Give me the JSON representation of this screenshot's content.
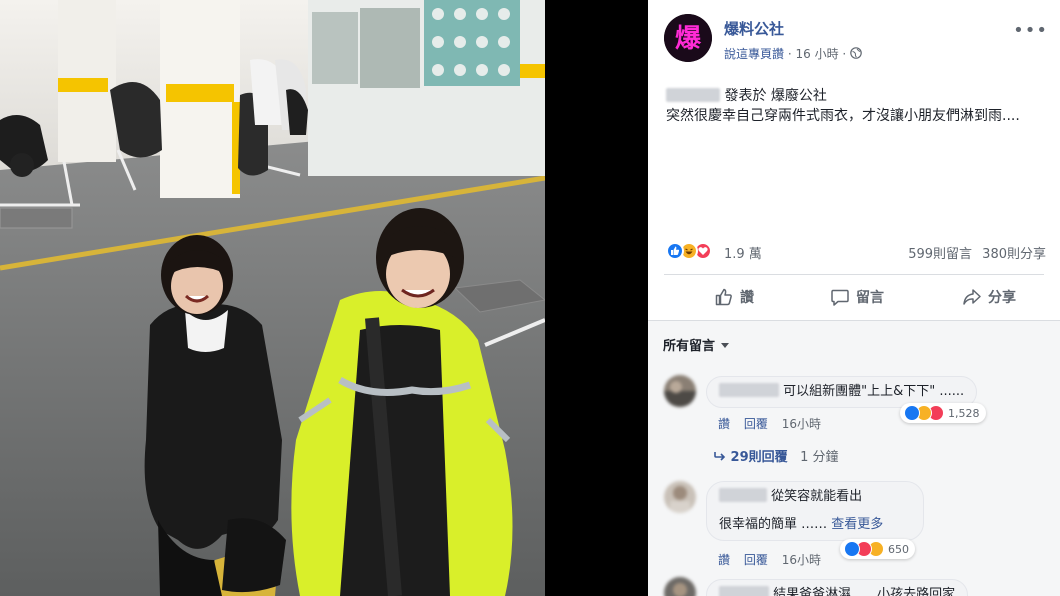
{
  "post": {
    "page_name": "爆料公社",
    "avatar_glyph": "爆",
    "like_page_label": "說這專頁讚",
    "separator": "·",
    "time": "16 小時",
    "more_label": "•••",
    "shared_suffix": "發表於 爆廢公社",
    "body": "突然很慶幸自己穿兩件式雨衣，才沒讓小朋友們淋到雨....",
    "reaction_count": "1.9 萬",
    "comment_count": "599則留言",
    "share_count": "380則分享"
  },
  "actions": {
    "like": "讚",
    "comment": "留言",
    "share": "分享"
  },
  "comments": {
    "sort_label": "所有留言",
    "items": [
      {
        "text": "可以組新團體\"上上&下下\" ......",
        "like": "讚",
        "reply": "回覆",
        "time": "16小時",
        "reaction_count": "1,528"
      },
      {
        "line1": "從笑容就能看出",
        "line2": "很幸福的簡單 ……",
        "see_more": "查看更多",
        "like": "讚",
        "reply": "回覆",
        "time": "16小時",
        "reaction_count": "650"
      },
      {
        "text": "結果爸爸淋濕……小孩去路回家"
      }
    ],
    "replies_label": "29則回覆",
    "replies_time": "1 分鐘"
  },
  "colors": {
    "link": "#385898",
    "secondary": "#606770",
    "like_blue": "#1877f2",
    "haha_yellow": "#f7b125",
    "love_red": "#f33e58",
    "raincoat_yellow": "#d9ef2a"
  }
}
